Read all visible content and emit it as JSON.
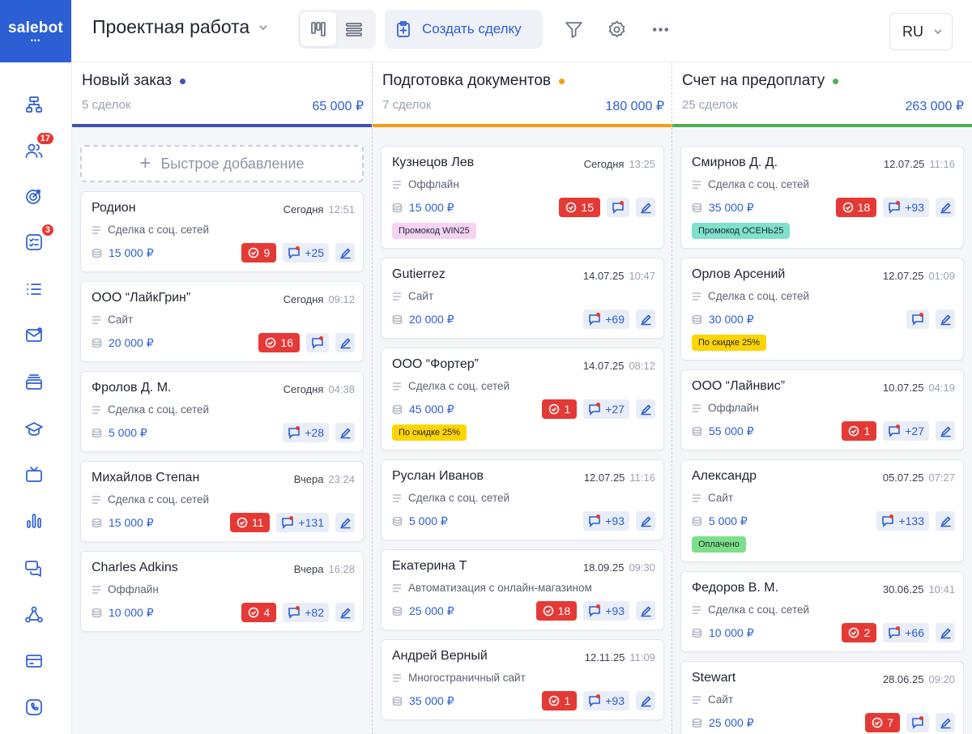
{
  "app": {
    "logo": "salebot",
    "logo_dots": "•••"
  },
  "header": {
    "title": "Проектная работа",
    "create_deal": "Создать сделку",
    "lang": "RU"
  },
  "sidebar": {
    "items": [
      {
        "icon": "structure-icon"
      },
      {
        "icon": "users-icon",
        "badge": "17"
      },
      {
        "icon": "target-icon"
      },
      {
        "icon": "tasks-icon",
        "badge": "3"
      },
      {
        "icon": "list-icon"
      },
      {
        "icon": "mail-icon"
      },
      {
        "icon": "cards-stack-icon"
      },
      {
        "icon": "graduation-icon"
      },
      {
        "icon": "tv-icon"
      },
      {
        "icon": "analytics-icon"
      },
      {
        "icon": "chats-icon"
      },
      {
        "icon": "integrations-icon"
      },
      {
        "icon": "payment-card-icon"
      },
      {
        "icon": "phone-icon"
      }
    ]
  },
  "board": {
    "quick_add": "Быстрое добавление",
    "columns": [
      {
        "title": "Новый заказ",
        "count": "5 сделок",
        "sum": "65 000 ₽",
        "color": "#3f51b5",
        "cards": [
          {
            "name": "Родион",
            "date": "Сегодня",
            "time": "12:51",
            "source": "Сделка с соц. сетей",
            "amount": "15 000 ₽",
            "tasks": "9",
            "messages": "+25"
          },
          {
            "name": "ООО “ЛайкГрин”",
            "date": "Сегодня",
            "time": "09:12",
            "source": "Сайт",
            "amount": "20 000 ₽",
            "tasks": "16",
            "messages": ""
          },
          {
            "name": "Фролов Д. М.",
            "date": "Сегодня",
            "time": "04:38",
            "source": "Сделка с соц. сетей",
            "amount": "5 000 ₽",
            "tasks": "",
            "messages": "+28"
          },
          {
            "name": "Михайлов Степан",
            "date": "Вчера",
            "time": "23:24",
            "source": "Сделка с соц. сетей",
            "amount": "15 000 ₽",
            "tasks": "11",
            "messages": "+131"
          },
          {
            "name": "Charles Adkins",
            "date": "Вчера",
            "time": "16:28",
            "source": "Оффлайн",
            "amount": "10 000 ₽",
            "tasks": "4",
            "messages": "+82"
          }
        ]
      },
      {
        "title": "Подготовка документов",
        "count": "7 сделок",
        "sum": "180 000 ₽",
        "color": "#f39c12",
        "cards": [
          {
            "name": "Кузнецов Лев",
            "date": "Сегодня",
            "time": "13:25",
            "source": "Оффлайн",
            "amount": "15 000 ₽",
            "tasks": "15",
            "messages": "",
            "tag": "Промокод WIN25",
            "tag_color": "#f6d3f3"
          },
          {
            "name": "Gutierrez",
            "date": "14.07.25",
            "time": "10:47",
            "source": "Сайт",
            "amount": "20 000 ₽",
            "tasks": "",
            "messages": "+69"
          },
          {
            "name": "ООО “Фортер”",
            "date": "14.07.25",
            "time": "08:12",
            "source": "Сделка с соц. сетей",
            "amount": "45 000 ₽",
            "tasks": "1",
            "messages": "+27",
            "tag": "По скидке 25%",
            "tag_color": "#ffd400"
          },
          {
            "name": "Руслан Иванов",
            "date": "12.07.25",
            "time": "11:16",
            "source": "Сделка с соц. сетей",
            "amount": "5 000 ₽",
            "tasks": "",
            "messages": "+93"
          },
          {
            "name": "Екатерина Т",
            "date": "18.09.25",
            "time": "09:30",
            "source": "Автоматизация с онлайн-магазином",
            "amount": "25 000 ₽",
            "tasks": "18",
            "messages": "+93"
          },
          {
            "name": "Андрей Верный",
            "date": "12.11.25",
            "time": "11:09",
            "source": "Многостраничный сайт",
            "amount": "35 000 ₽",
            "tasks": "1",
            "messages": "+93"
          }
        ]
      },
      {
        "title": "Счет на предоплату",
        "count": "25 сделок",
        "sum": "263 000 ₽",
        "color": "#4caf50",
        "cards": [
          {
            "name": "Смирнов Д. Д.",
            "date": "12.07.25",
            "time": "11:16",
            "source": "Сделка с соц. сетей",
            "amount": "35 000 ₽",
            "tasks": "18",
            "messages": "+93",
            "tag": "Промокод ОСЕНЬ25",
            "tag_color": "#7fe0cc"
          },
          {
            "name": "Орлов Арсений",
            "date": "12.07.25",
            "time": "01:09",
            "source": "Сделка с соц. сетей",
            "amount": "30 000 ₽",
            "tasks": "",
            "messages": "",
            "tag": "По скидке 25%",
            "tag_color": "#ffd400"
          },
          {
            "name": "ООО “Лайнвис”",
            "date": "10.07.25",
            "time": "04:19",
            "source": "Оффлайн",
            "amount": "55 000 ₽",
            "tasks": "1",
            "messages": "+27"
          },
          {
            "name": "Александр",
            "date": "05.07.25",
            "time": "07:27",
            "source": "Сайт",
            "amount": "5 000 ₽",
            "tasks": "",
            "messages": "+133",
            "tag": "Оплачено",
            "tag_color": "#7ddf8a"
          },
          {
            "name": "Федоров В. М.",
            "date": "30.06.25",
            "time": "10:41",
            "source": "Сделка с соц. сетей",
            "amount": "10 000 ₽",
            "tasks": "2",
            "messages": "+66"
          },
          {
            "name": "Stewart",
            "date": "28.06.25",
            "time": "09:20",
            "source": "Сайт",
            "amount": "25 000 ₽",
            "tasks": "7",
            "messages": ""
          }
        ]
      }
    ]
  }
}
